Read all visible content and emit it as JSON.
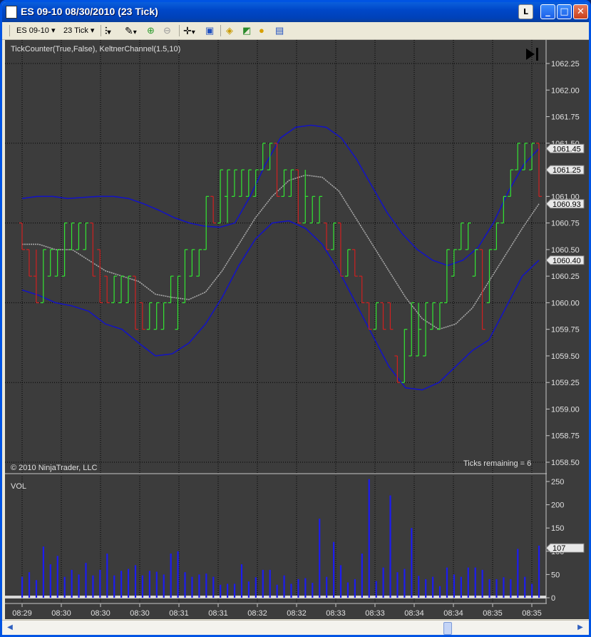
{
  "window": {
    "title": "ES 09-10  08/30/2010 (23 Tick)",
    "l_button": "L",
    "minimize": "_",
    "maximize": "□",
    "close": "✕"
  },
  "toolbar": {
    "instrument": "ES 09-10",
    "interval": "23 Tick",
    "icons": [
      "bar-style-icon",
      "draw-tool-icon",
      "zoom-in-icon",
      "zoom-out-icon",
      "crosshair-icon",
      "properties-icon",
      "data-series-icon",
      "indicators-icon",
      "strategies-icon",
      "data-box-icon"
    ]
  },
  "colors": {
    "background": "#3c3c3c",
    "up_bar": "#32e632",
    "down_bar": "#d02020",
    "channel": "#1414c0",
    "midline": "#a8a8a8",
    "volume": "#1c1cf0"
  },
  "chart_data": {
    "type": "ohlc",
    "indicator_label": "TickCounter(True,False), KeltnerChannel(1.5,10)",
    "copyright": "© 2010 NinjaTrader, LLC",
    "ticks_remaining": "Ticks remaining = 6",
    "price_ylim": [
      1058.5,
      1062.25
    ],
    "price_ticks": [
      "1062.25",
      "1062.00",
      "1061.75",
      "1061.50",
      "1061.25",
      "1061.00",
      "1060.75",
      "1060.50",
      "1060.25",
      "1060.00",
      "1059.75",
      "1059.50",
      "1059.25",
      "1059.00",
      "1058.75",
      "1058.50"
    ],
    "price_markers": [
      {
        "label": "1061.45",
        "value": 1061.45
      },
      {
        "label": "1061.25",
        "value": 1061.25
      },
      {
        "label": "1060.93",
        "value": 1060.93
      },
      {
        "label": "1060.40",
        "value": 1060.4
      }
    ],
    "time_labels": [
      "08:29",
      "08:30",
      "08:30",
      "08:30",
      "08:31",
      "08:31",
      "08:32",
      "08:32",
      "08:33",
      "08:33",
      "08:34",
      "08:34",
      "08:35",
      "08:35"
    ],
    "bars": [
      {
        "o": 1060.75,
        "h": 1060.75,
        "l": 1060.5,
        "c": 1060.5
      },
      {
        "o": 1060.5,
        "h": 1060.5,
        "l": 1060.25,
        "c": 1060.25
      },
      {
        "o": 1060.25,
        "h": 1060.5,
        "l": 1060.0,
        "c": 1060.0
      },
      {
        "o": 1060.0,
        "h": 1060.5,
        "l": 1060.0,
        "c": 1060.5
      },
      {
        "o": 1060.25,
        "h": 1060.5,
        "l": 1060.25,
        "c": 1060.5
      },
      {
        "o": 1060.25,
        "h": 1060.5,
        "l": 1060.25,
        "c": 1060.5
      },
      {
        "o": 1060.25,
        "h": 1060.75,
        "l": 1060.25,
        "c": 1060.75
      },
      {
        "o": 1060.5,
        "h": 1060.75,
        "l": 1060.5,
        "c": 1060.75
      },
      {
        "o": 1060.5,
        "h": 1060.75,
        "l": 1060.5,
        "c": 1060.75
      },
      {
        "o": 1060.5,
        "h": 1060.75,
        "l": 1060.5,
        "c": 1060.75
      },
      {
        "o": 1060.75,
        "h": 1060.75,
        "l": 1060.25,
        "c": 1060.25
      },
      {
        "o": 1060.5,
        "h": 1060.5,
        "l": 1060.0,
        "c": 1060.0
      },
      {
        "o": 1060.25,
        "h": 1060.25,
        "l": 1060.0,
        "c": 1060.0
      },
      {
        "o": 1060.0,
        "h": 1060.25,
        "l": 1060.0,
        "c": 1060.25
      },
      {
        "o": 1060.0,
        "h": 1060.25,
        "l": 1060.0,
        "c": 1060.25
      },
      {
        "o": 1060.0,
        "h": 1060.25,
        "l": 1060.0,
        "c": 1060.25
      },
      {
        "o": 1060.25,
        "h": 1060.25,
        "l": 1059.75,
        "c": 1059.75
      },
      {
        "o": 1060.0,
        "h": 1060.0,
        "l": 1059.75,
        "c": 1059.75
      },
      {
        "o": 1059.75,
        "h": 1060.0,
        "l": 1059.75,
        "c": 1060.0
      },
      {
        "o": 1059.75,
        "h": 1060.0,
        "l": 1059.75,
        "c": 1060.0
      },
      {
        "o": 1059.75,
        "h": 1060.0,
        "l": 1059.75,
        "c": 1060.0
      },
      {
        "o": 1060.0,
        "h": 1060.25,
        "l": 1060.0,
        "c": 1060.25
      },
      {
        "o": 1059.75,
        "h": 1060.25,
        "l": 1059.75,
        "c": 1060.25
      },
      {
        "o": 1060.0,
        "h": 1060.5,
        "l": 1060.0,
        "c": 1060.5
      },
      {
        "o": 1060.25,
        "h": 1060.5,
        "l": 1060.25,
        "c": 1060.5
      },
      {
        "o": 1060.25,
        "h": 1060.5,
        "l": 1060.25,
        "c": 1060.5
      },
      {
        "o": 1060.5,
        "h": 1061.0,
        "l": 1060.5,
        "c": 1061.0
      },
      {
        "o": 1061.0,
        "h": 1061.0,
        "l": 1060.75,
        "c": 1060.75
      },
      {
        "o": 1060.75,
        "h": 1061.25,
        "l": 1060.75,
        "c": 1061.25
      },
      {
        "o": 1061.0,
        "h": 1061.25,
        "l": 1060.75,
        "c": 1061.25
      },
      {
        "o": 1061.0,
        "h": 1061.25,
        "l": 1061.0,
        "c": 1061.25
      },
      {
        "o": 1061.0,
        "h": 1061.25,
        "l": 1061.0,
        "c": 1061.25
      },
      {
        "o": 1061.0,
        "h": 1061.25,
        "l": 1061.0,
        "c": 1061.25
      },
      {
        "o": 1061.0,
        "h": 1061.25,
        "l": 1061.0,
        "c": 1061.25
      },
      {
        "o": 1061.25,
        "h": 1061.5,
        "l": 1061.25,
        "c": 1061.5
      },
      {
        "o": 1061.25,
        "h": 1061.5,
        "l": 1061.25,
        "c": 1061.5
      },
      {
        "o": 1061.5,
        "h": 1061.5,
        "l": 1061.0,
        "c": 1061.0
      },
      {
        "o": 1061.0,
        "h": 1061.25,
        "l": 1061.0,
        "c": 1061.25
      },
      {
        "o": 1061.0,
        "h": 1061.25,
        "l": 1061.0,
        "c": 1061.25
      },
      {
        "o": 1061.25,
        "h": 1061.25,
        "l": 1060.75,
        "c": 1060.75
      },
      {
        "o": 1060.75,
        "h": 1061.25,
        "l": 1060.75,
        "c": 1061.0
      },
      {
        "o": 1060.75,
        "h": 1061.0,
        "l": 1060.75,
        "c": 1061.0
      },
      {
        "o": 1060.75,
        "h": 1061.0,
        "l": 1060.75,
        "c": 1061.0
      },
      {
        "o": 1060.75,
        "h": 1060.75,
        "l": 1060.5,
        "c": 1060.5
      },
      {
        "o": 1060.5,
        "h": 1060.75,
        "l": 1060.5,
        "c": 1060.75
      },
      {
        "o": 1060.75,
        "h": 1060.75,
        "l": 1060.25,
        "c": 1060.25
      },
      {
        "o": 1060.25,
        "h": 1060.5,
        "l": 1060.25,
        "c": 1060.5
      },
      {
        "o": 1060.5,
        "h": 1060.5,
        "l": 1060.25,
        "c": 1060.25
      },
      {
        "o": 1060.25,
        "h": 1060.25,
        "l": 1060.0,
        "c": 1060.0
      },
      {
        "o": 1060.0,
        "h": 1060.0,
        "l": 1059.75,
        "c": 1059.75
      },
      {
        "o": 1059.75,
        "h": 1060.0,
        "l": 1059.75,
        "c": 1060.0
      },
      {
        "o": 1060.0,
        "h": 1060.0,
        "l": 1059.75,
        "c": 1059.75
      },
      {
        "o": 1060.0,
        "h": 1060.0,
        "l": 1059.75,
        "c": 1059.75
      },
      {
        "o": 1059.5,
        "h": 1059.5,
        "l": 1059.25,
        "c": 1059.25
      },
      {
        "o": 1059.25,
        "h": 1059.75,
        "l": 1059.25,
        "c": 1059.75
      },
      {
        "o": 1059.5,
        "h": 1060.0,
        "l": 1059.5,
        "c": 1060.0
      },
      {
        "o": 1059.5,
        "h": 1060.0,
        "l": 1059.5,
        "c": 1059.75
      },
      {
        "o": 1059.5,
        "h": 1060.0,
        "l": 1059.5,
        "c": 1060.0
      },
      {
        "o": 1059.75,
        "h": 1060.0,
        "l": 1059.75,
        "c": 1060.0
      },
      {
        "o": 1059.75,
        "h": 1060.0,
        "l": 1059.75,
        "c": 1060.0
      },
      {
        "o": 1060.0,
        "h": 1060.5,
        "l": 1060.0,
        "c": 1060.5
      },
      {
        "o": 1060.25,
        "h": 1060.5,
        "l": 1060.25,
        "c": 1060.5
      },
      {
        "o": 1060.5,
        "h": 1060.75,
        "l": 1060.5,
        "c": 1060.75
      },
      {
        "o": 1060.5,
        "h": 1060.75,
        "l": 1060.5,
        "c": 1060.75
      },
      {
        "o": 1060.25,
        "h": 1060.5,
        "l": 1060.25,
        "c": 1060.5
      },
      {
        "o": 1060.5,
        "h": 1060.5,
        "l": 1059.75,
        "c": 1059.75
      },
      {
        "o": 1060.0,
        "h": 1060.5,
        "l": 1060.0,
        "c": 1060.5
      },
      {
        "o": 1060.5,
        "h": 1060.75,
        "l": 1060.5,
        "c": 1060.75
      },
      {
        "o": 1060.75,
        "h": 1061.0,
        "l": 1060.75,
        "c": 1061.0
      },
      {
        "o": 1061.0,
        "h": 1061.25,
        "l": 1061.0,
        "c": 1061.25
      },
      {
        "o": 1061.25,
        "h": 1061.5,
        "l": 1061.25,
        "c": 1061.5
      },
      {
        "o": 1061.25,
        "h": 1061.5,
        "l": 1061.25,
        "c": 1061.5
      },
      {
        "o": 1061.25,
        "h": 1061.5,
        "l": 1061.25,
        "c": 1061.5
      },
      {
        "o": 1061.5,
        "h": 1061.5,
        "l": 1061.0,
        "c": 1061.0
      }
    ],
    "keltner_upper": [
      1060.98,
      1061.0,
      1061.0,
      1060.98,
      1060.99,
      1061.0,
      1061.0,
      1060.98,
      1060.93,
      1060.87,
      1060.8,
      1060.75,
      1060.72,
      1060.71,
      1060.75,
      1061.0,
      1061.3,
      1061.55,
      1061.65,
      1061.67,
      1061.65,
      1061.55,
      1061.35,
      1061.1,
      1060.85,
      1060.65,
      1060.5,
      1060.4,
      1060.35,
      1060.4,
      1060.52,
      1060.75,
      1061.05,
      1061.3,
      1061.45
    ],
    "keltner_mid": [
      1060.55,
      1060.55,
      1060.5,
      1060.5,
      1060.4,
      1060.3,
      1060.25,
      1060.2,
      1060.08,
      1060.05,
      1060.03,
      1060.1,
      1060.3,
      1060.55,
      1060.8,
      1061.0,
      1061.15,
      1061.2,
      1061.18,
      1061.05,
      1060.8,
      1060.55,
      1060.3,
      1060.05,
      1059.85,
      1059.75,
      1059.8,
      1059.95,
      1060.2,
      1060.45,
      1060.7,
      1060.93
    ],
    "keltner_lower": [
      1060.12,
      1060.07,
      1060.0,
      1059.97,
      1059.92,
      1059.8,
      1059.75,
      1059.62,
      1059.5,
      1059.52,
      1059.62,
      1059.8,
      1060.05,
      1060.35,
      1060.6,
      1060.75,
      1060.77,
      1060.7,
      1060.55,
      1060.3,
      1060.0,
      1059.7,
      1059.4,
      1059.2,
      1059.18,
      1059.25,
      1059.4,
      1059.55,
      1059.65,
      1059.95,
      1060.25,
      1060.4
    ],
    "volume": {
      "label": "VOL",
      "ylim": [
        0,
        250
      ],
      "ticks": [
        "250",
        "200",
        "150",
        "100",
        "50",
        "0"
      ],
      "marker": {
        "label": "107",
        "value": 107
      },
      "values": [
        45,
        55,
        38,
        110,
        72,
        90,
        45,
        60,
        50,
        75,
        48,
        60,
        95,
        48,
        58,
        62,
        70,
        48,
        58,
        56,
        50,
        95,
        100,
        55,
        45,
        50,
        52,
        45,
        28,
        30,
        30,
        72,
        35,
        44,
        60,
        60,
        28,
        48,
        30,
        40,
        42,
        32,
        170,
        45,
        120,
        70,
        33,
        40,
        95,
        255,
        36,
        65,
        220,
        55,
        62,
        150,
        47,
        40,
        45,
        25,
        65,
        50,
        45,
        65,
        65,
        60,
        40,
        40,
        44,
        40,
        105,
        45,
        30,
        112
      ]
    }
  }
}
